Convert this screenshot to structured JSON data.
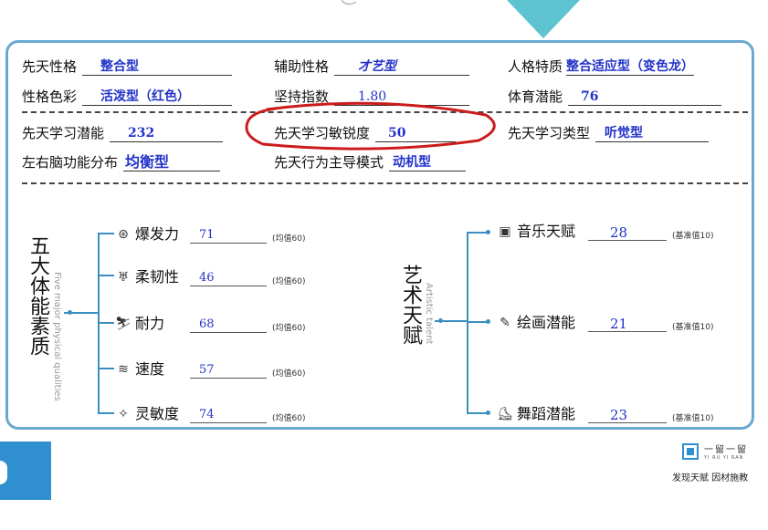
{
  "traits": {
    "innate_personality": {
      "label": "先天性格",
      "value": "整合型"
    },
    "aux_personality": {
      "label": "辅助性格",
      "value": "才艺型"
    },
    "personality_trait": {
      "label": "人格特质",
      "value": "整合适应型（变色龙）"
    },
    "personality_color": {
      "label": "性格色彩",
      "value": "活泼型（红色）"
    },
    "persistence_index": {
      "label": "坚持指数",
      "value": "1.80"
    },
    "sports_potential": {
      "label": "体育潜能",
      "value": "76"
    },
    "learning_potential": {
      "label": "先天学习潜能",
      "value": "232"
    },
    "learning_sensitivity": {
      "label": "先天学习敏锐度",
      "value": "50"
    },
    "learning_type": {
      "label": "先天学习类型",
      "value": "听觉型"
    },
    "brain_distribution": {
      "label": "左右脑功能分布",
      "value": "均衡型"
    },
    "behavior_mode": {
      "label": "先天行为主导模式",
      "value": "动机型"
    }
  },
  "physical": {
    "title": "五大体能素质",
    "subtitle": "Five major physical qualities",
    "items": [
      {
        "name": "爆发力",
        "value": "71",
        "note": "(均值60)",
        "icon": "explosive-icon"
      },
      {
        "name": "柔韧性",
        "value": "46",
        "note": "(均值60)",
        "icon": "flexibility-icon"
      },
      {
        "name": "耐力",
        "value": "68",
        "note": "(均值60)",
        "icon": "endurance-icon"
      },
      {
        "name": "速度",
        "value": "57",
        "note": "(均值60)",
        "icon": "speed-icon"
      },
      {
        "name": "灵敏度",
        "value": "74",
        "note": "(均值60)",
        "icon": "agility-icon"
      }
    ]
  },
  "art": {
    "title": "艺术天赋",
    "subtitle": "Artistic talent",
    "items": [
      {
        "name": "音乐天赋",
        "value": "28",
        "note": "(基准值10)",
        "icon": "radio-icon"
      },
      {
        "name": "绘画潜能",
        "value": "21",
        "note": "(基准值10)",
        "icon": "paintbrush-icon"
      },
      {
        "name": "舞蹈潜能",
        "value": "23",
        "note": "(基准值10)",
        "icon": "dance-shoe-icon"
      }
    ]
  },
  "branding": {
    "logo_text": "一留一留",
    "logo_small": "YI  RU  YI  RAN",
    "slogan": "发现天赋 因材施教"
  },
  "colors": {
    "accent": "#3a8fc2",
    "value_blue": "#2233c8",
    "highlight_red": "#cc1b1b",
    "teal": "#5ec3d0"
  }
}
